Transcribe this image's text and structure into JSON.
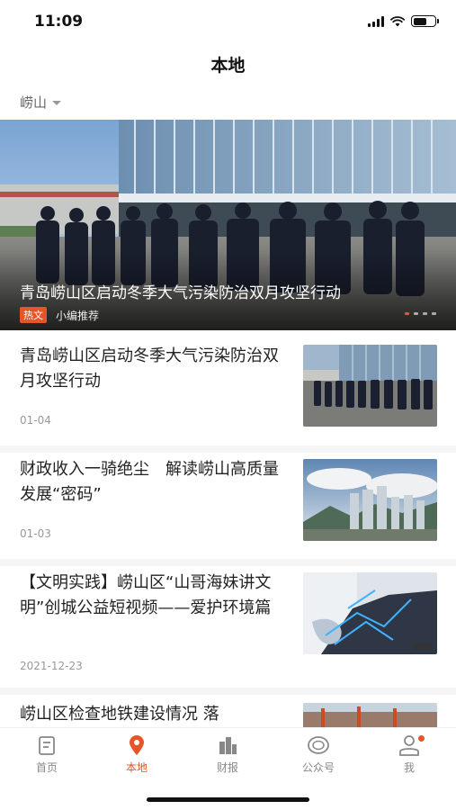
{
  "status": {
    "time": "11:09"
  },
  "header": {
    "title": "本地"
  },
  "location": {
    "selected": "崂山"
  },
  "banner": {
    "title": "青岛崂山区启动冬季大气污染防治双月攻坚行动",
    "tag": "热文",
    "source": "小编推荐",
    "slide_count": 4,
    "active_slide": 1
  },
  "news": [
    {
      "title": "青岛崂山区启动冬季大气污染防治双月攻坚行动",
      "date": "01-04"
    },
    {
      "title": "财政收入一骑绝尘　解读崂山高质量发展“密码”",
      "date": "01-03"
    },
    {
      "title": "【文明实践】崂山区“山哥海妹讲文明”创城公益短视频——爱护环境篇",
      "date": "2021-12-23"
    },
    {
      "title": "崂山区检查地铁建设情况 落",
      "date": ""
    }
  ],
  "tabs": [
    {
      "label": "首页",
      "icon": "home-icon"
    },
    {
      "label": "本地",
      "icon": "location-pin-icon"
    },
    {
      "label": "财报",
      "icon": "buildings-icon"
    },
    {
      "label": "公众号",
      "icon": "public-account-icon"
    },
    {
      "label": "我",
      "icon": "user-icon"
    }
  ],
  "colors": {
    "accent": "#e65527"
  }
}
